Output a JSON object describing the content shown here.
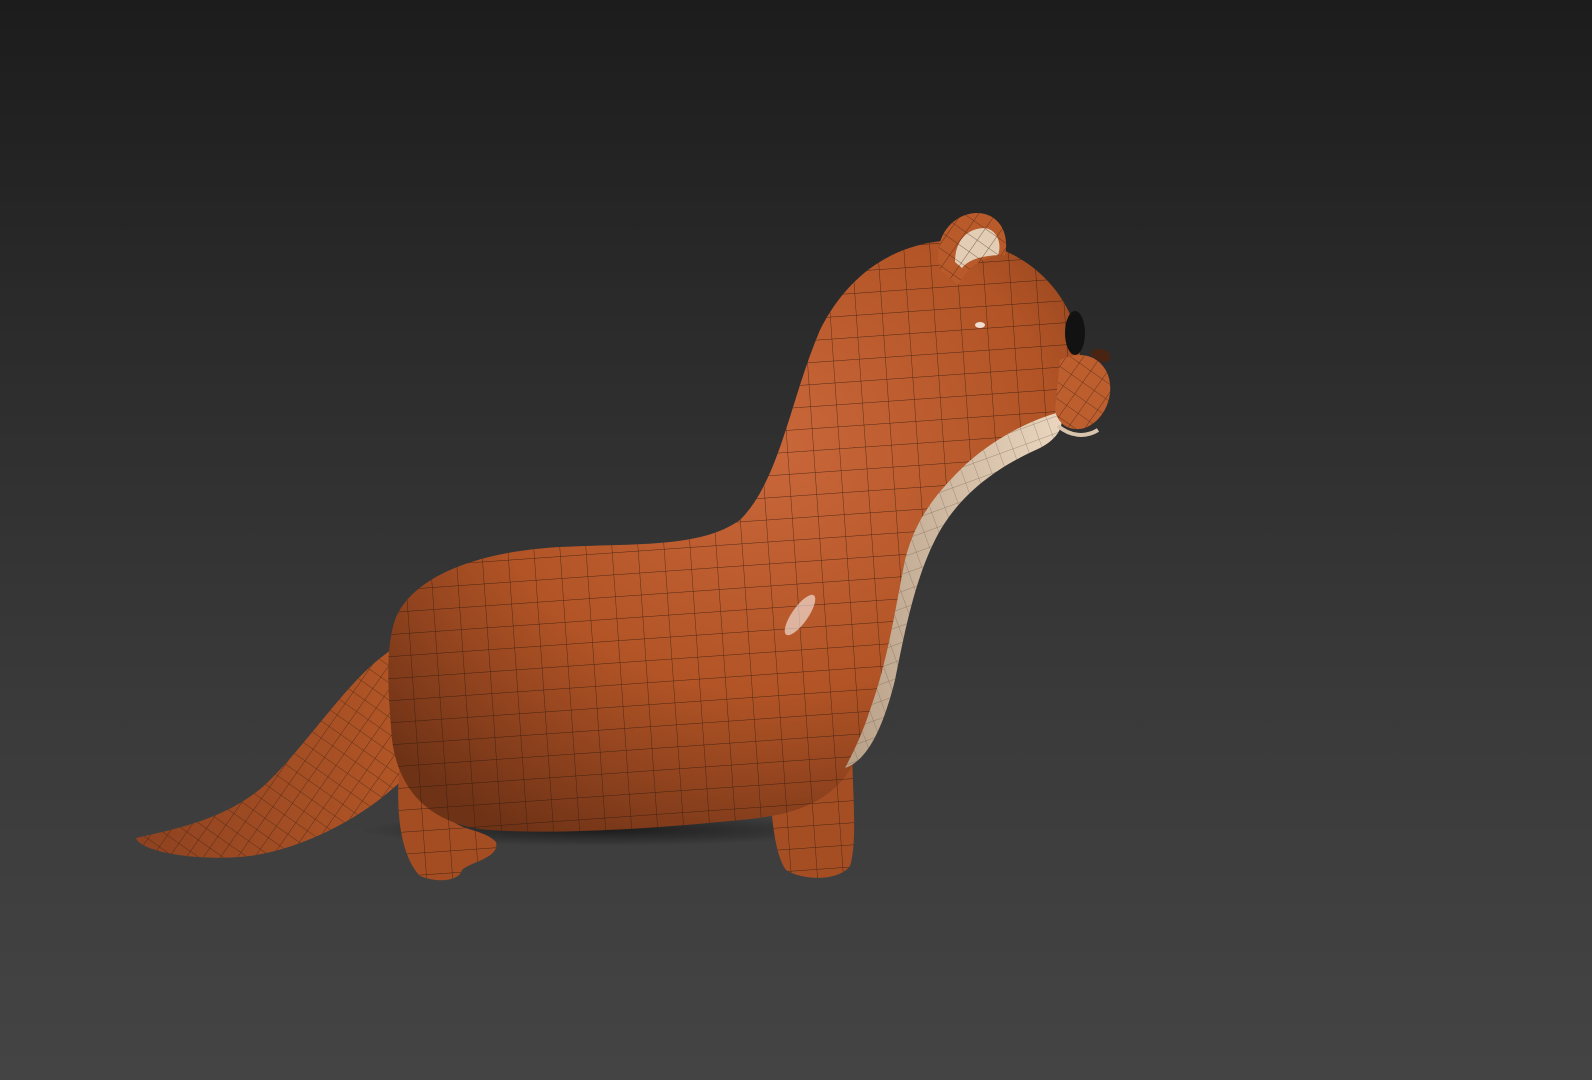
{
  "viewport": {
    "background_top": "#1c1c1c",
    "background_bottom": "#444444"
  },
  "model": {
    "subject": "otter-character",
    "shading": "smooth-with-wireframe",
    "body_color": "#b85a2a",
    "body_shadow_color": "#6e3216",
    "belly_color": "#d9c2a8",
    "eye_color": "#121212",
    "nose_color": "#4a2412",
    "wire_color": "#2a160c"
  }
}
